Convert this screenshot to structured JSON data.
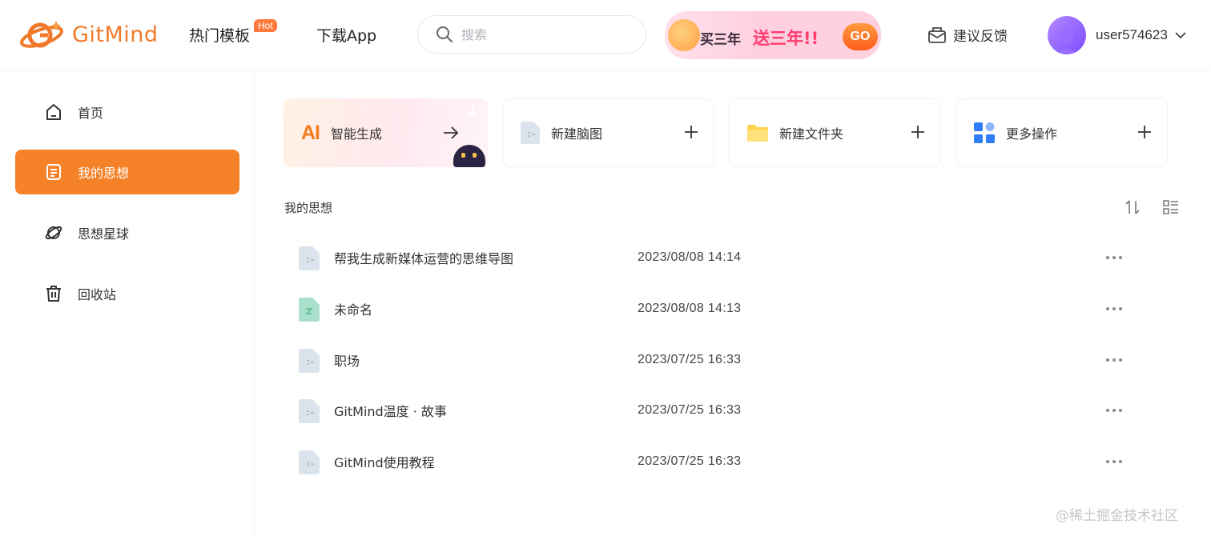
{
  "header": {
    "brand": "GitMind",
    "nav": {
      "templates": "热门模板",
      "hot_badge": "Hot",
      "download": "下载App"
    },
    "search": {
      "placeholder": "搜索"
    },
    "promo": {
      "text1": "买三年",
      "text2": "送三年!!",
      "go": "GO"
    },
    "feedback": "建议反馈",
    "username": "user574623"
  },
  "sidebar": {
    "items": [
      {
        "label": "首页",
        "icon": "home-icon"
      },
      {
        "label": "我的思想",
        "icon": "document-icon",
        "active": true
      },
      {
        "label": "思想星球",
        "icon": "planet-icon"
      },
      {
        "label": "回收站",
        "icon": "trash-icon"
      }
    ]
  },
  "cards": {
    "ai": {
      "mark": "AI",
      "label": "智能生成"
    },
    "new_map": "新建脑图",
    "new_folder": "新建文件夹",
    "more_actions": "更多操作"
  },
  "section": {
    "title": "我的思想"
  },
  "files": [
    {
      "name": "帮我生成新媒体运营的思维导图",
      "date": "2023/08/08 14:14",
      "icon": "mindmap-file-icon"
    },
    {
      "name": "未命名",
      "date": "2023/08/08 14:13",
      "icon": "flowchart-file-icon"
    },
    {
      "name": "职场",
      "date": "2023/07/25 16:33",
      "icon": "mindmap-file-icon"
    },
    {
      "name": "GitMind温度 · 故事",
      "date": "2023/07/25 16:33",
      "icon": "mindmap-file-icon"
    },
    {
      "name": "GitMind使用教程",
      "date": "2023/07/25 16:33",
      "icon": "mindmap-file-icon"
    }
  ],
  "watermark": "@稀土掘金技术社区",
  "colors": {
    "accent": "#f58128",
    "brand_orange": "#f07a2a",
    "hot_badge": "#ff7a3a"
  }
}
